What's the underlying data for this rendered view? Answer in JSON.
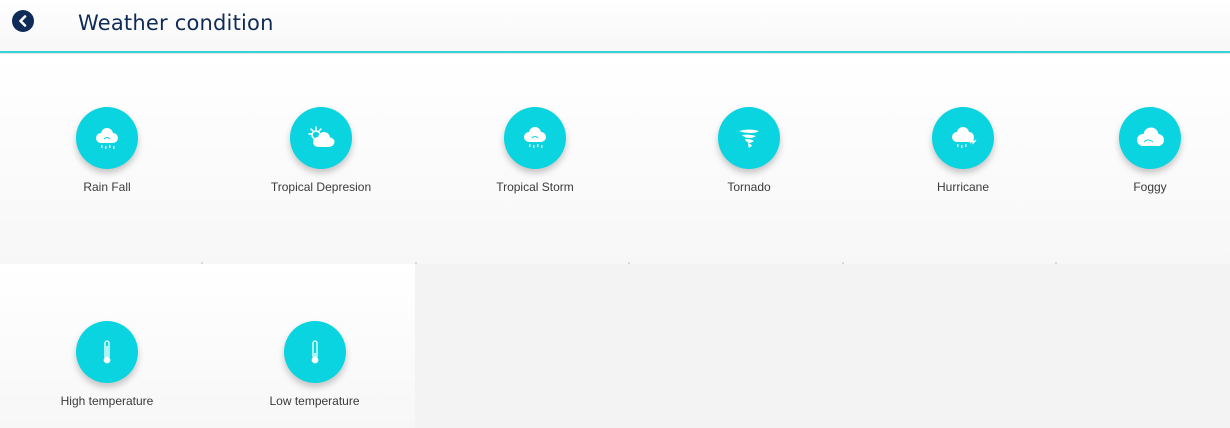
{
  "header": {
    "title": "Weather condition",
    "back_icon": "chevron-left-circle-icon"
  },
  "accent_color": "#0ad4e0",
  "header_border_color": "#36d3da",
  "title_color": "#0f2b57",
  "conditions": [
    {
      "label": "Rain Fall",
      "icon": "rain-cloud-icon"
    },
    {
      "label": "Tropical Depresion",
      "icon": "sun-cloud-icon"
    },
    {
      "label": "Tropical Storm",
      "icon": "storm-cloud-icon"
    },
    {
      "label": "Tornado",
      "icon": "tornado-icon"
    },
    {
      "label": "Hurricane",
      "icon": "hurricane-icon"
    },
    {
      "label": "Foggy",
      "icon": "fog-cloud-icon"
    },
    {
      "label": "High temperature",
      "icon": "thermometer-high-icon"
    },
    {
      "label": "Low temperature",
      "icon": "thermometer-low-icon"
    }
  ]
}
